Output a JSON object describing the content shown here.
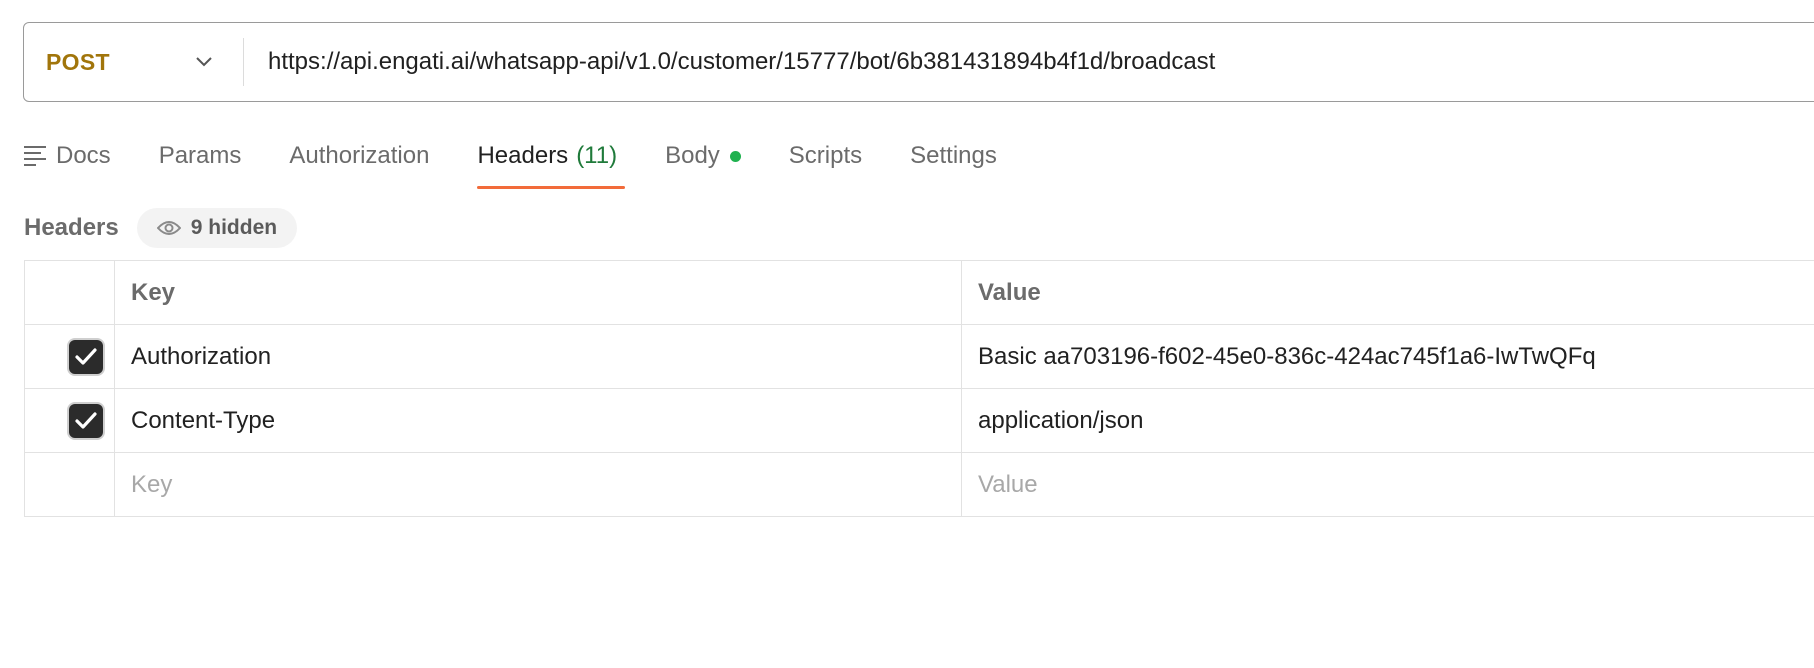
{
  "request": {
    "method": "POST",
    "url": "https://api.engati.ai/whatsapp-api/v1.0/customer/15777/bot/6b381431894b4f1d/broadcast"
  },
  "tabs": [
    {
      "label": "Docs",
      "icon": "docs-icon"
    },
    {
      "label": "Params"
    },
    {
      "label": "Authorization"
    },
    {
      "label": "Headers",
      "count": "(11)",
      "active": true
    },
    {
      "label": "Body",
      "status_dot_color": "#1fb14f"
    },
    {
      "label": "Scripts"
    },
    {
      "label": "Settings"
    }
  ],
  "headers_section": {
    "title": "Headers",
    "hidden_label": "9 hidden",
    "columns": {
      "key": "Key",
      "value": "Value"
    },
    "rows": [
      {
        "checked": true,
        "key": "Authorization",
        "value": "Basic aa703196-f602-45e0-836c-424ac745f1a6-IwTwQFq"
      },
      {
        "checked": true,
        "key": "Content-Type",
        "value": "application/json"
      }
    ],
    "new_row": {
      "key_placeholder": "Key",
      "value_placeholder": "Value"
    }
  },
  "colors": {
    "method": "#a1750b",
    "active_tab_underline": "#f26b3a",
    "count": "#1f7a3a"
  }
}
